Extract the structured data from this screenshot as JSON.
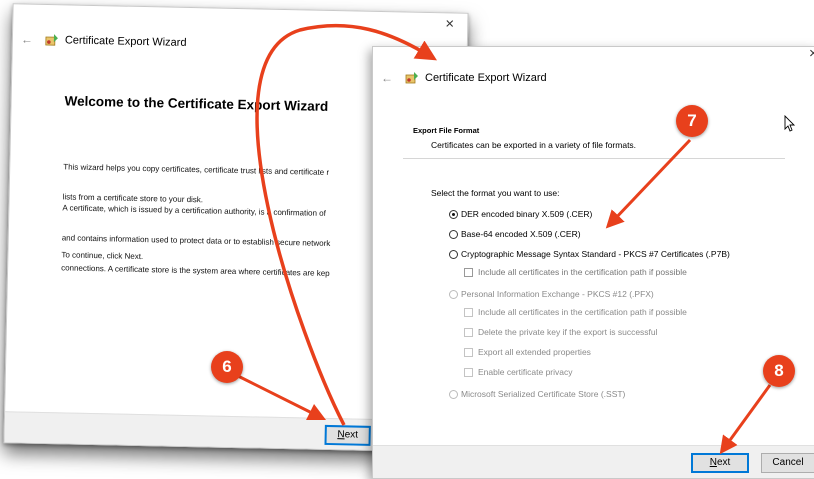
{
  "window1": {
    "close_glyph": "×",
    "title": "Certificate Export Wizard",
    "heading": "Welcome to the Certificate Export Wizard",
    "para1_line1": "This wizard helps you copy certificates, certificate trust lists and certificate r",
    "para1_line2": "lists from a certificate store to your disk.",
    "para2_line1": "A certificate, which is issued by a certification authority, is a confirmation of",
    "para2_line2": "and contains information used to protect data or to establish secure network",
    "para2_line3": "connections. A certificate store is the system area where certificates are kep",
    "para3": "To continue, click Next.",
    "next_first": "N",
    "next_rest": "ext"
  },
  "window2": {
    "close_glyph": "×",
    "title": "Certificate Export Wizard",
    "section_title": "Export File Format",
    "section_desc": "Certificates can be exported in a variety of file formats.",
    "prompt": "Select the format you want to use:",
    "options": [
      {
        "label": "DER encoded binary X.509 (.CER)",
        "checked": true
      },
      {
        "label": "Base-64 encoded X.509 (.CER)",
        "checked": false
      },
      {
        "label": "Cryptographic Message Syntax Standard - PKCS #7 Certificates (.P7B)",
        "checked": false
      },
      {
        "label": "Personal Information Exchange - PKCS #12 (.PFX)",
        "checked": false
      },
      {
        "label": "Microsoft Serialized Certificate Store (.SST)",
        "checked": false
      }
    ],
    "p7b_checkbox": "Include all certificates in the certification path if possible",
    "pfx_checkboxes": [
      "Include all certificates in the certification path if possible",
      "Delete the private key if the export is successful",
      "Export all extended properties",
      "Enable certificate privacy"
    ],
    "next_first": "N",
    "next_rest": "ext",
    "cancel": "Cancel"
  },
  "annotations": {
    "badge6": "6",
    "badge7": "7",
    "badge8": "8",
    "color": "#e8401c"
  }
}
